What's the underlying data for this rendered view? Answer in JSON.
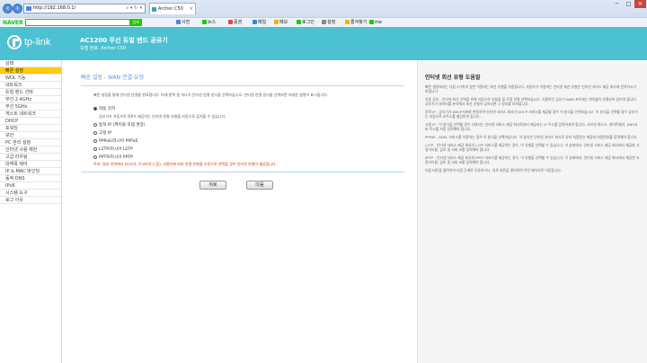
{
  "browser": {
    "address": "http://192.168.0.1/",
    "address_tools": "⌕ ▾ ↻ ✕",
    "tab_title": "Archer C50",
    "naver_logo": "NAVER",
    "naver_go": "검색",
    "toolbar": [
      {
        "label": "사전",
        "color": "#4f84d0"
      },
      {
        "label": "뉴스",
        "color": "#1ec800"
      },
      {
        "label": "증권",
        "color": "#e04646"
      },
      {
        "label": "메일",
        "color": "#2c8bd6"
      },
      {
        "label": "메모",
        "color": "#f0b400"
      },
      {
        "label": "로그인",
        "color": "#1ec800"
      },
      {
        "label": "설정",
        "color": "#888888"
      },
      {
        "label": "즐겨찾기",
        "color": "#f0b400"
      },
      {
        "label": "me",
        "color": "#1ec800"
      }
    ],
    "win_min": "─",
    "win_max": "□",
    "win_close": "✕"
  },
  "header": {
    "logo": "tp-link",
    "title": "AC1200 무선 듀얼 밴드 공유기",
    "subtitle": "모델 번호: Archer C50"
  },
  "sidebar": {
    "items": [
      {
        "label": "상태",
        "active": false
      },
      {
        "label": "빠른 설정",
        "active": true
      },
      {
        "label": "WDL 기능",
        "active": false
      },
      {
        "label": "네트워크",
        "active": false
      },
      {
        "label": "듀얼 밴드 선택",
        "active": false
      },
      {
        "label": "무선 2.4GHz",
        "active": false
      },
      {
        "label": "무선 5GHz",
        "active": false
      },
      {
        "label": "게스트 네트워크",
        "active": false
      },
      {
        "label": "DHCP",
        "active": false
      },
      {
        "label": "포워딩",
        "active": false
      },
      {
        "label": "보안",
        "active": false
      },
      {
        "label": "PC 관리 설정",
        "active": false
      },
      {
        "label": "인터넷 사용 제한",
        "active": false
      },
      {
        "label": "고급 라우팅",
        "active": false
      },
      {
        "label": "대역폭 제어",
        "active": false
      },
      {
        "label": "IP & MAC 바인딩",
        "active": false
      },
      {
        "label": "동적 DNS",
        "active": false
      },
      {
        "label": "IPv6",
        "active": false
      },
      {
        "label": "시스템 도구",
        "active": false
      },
      {
        "label": "로그 아웃",
        "active": false
      }
    ]
  },
  "content": {
    "title": "빠른 설정 - WAN 연결 유형",
    "description": "빠른 설정을 통해 인터넷 연결을 완료합니다. 아래 항목 중 하나가 인터넷 연결 방식을 선택하십시오. 인터넷 연결 방식을 선택하면 자세한 설명이 표시됩니다.",
    "options": [
      {
        "label": "자동 감지",
        "selected": true,
        "note": "공유기가 자동으로 ISP가 제공하는 인터넷 연결 유형을 자동으로 감지할 수 있습니다."
      },
      {
        "label": "동적 IP (케이블 모뎀 권장)",
        "selected": false,
        "note": ""
      },
      {
        "label": "고정 IP",
        "selected": false,
        "note": ""
      },
      {
        "label": "PPPoE/러시아 PPPoE",
        "selected": false,
        "note": ""
      },
      {
        "label": "L2TP/러시아 L2TP",
        "selected": false,
        "note": ""
      },
      {
        "label": "PPTP/러시아 PPTP",
        "selected": false,
        "note": ""
      }
    ],
    "warning": "주의: 일부 지역에서 (러시아, 우크라이나 등), 사용자에 따라 연결 유형을 수동으로 선택할 경우 인터넷 연결이 제공합니다.",
    "back_button": "뒤로",
    "next_button": "다음"
  },
  "help": {
    "title": "인터넷 회선 유형 도움말",
    "paragraphs": [
      {
        "lead": "",
        "text": "빠른 설정에서는 다음 3가지의 일반 이용되는 회선 유형을 지원합니다. 사용자가 이용하는 인터넷 회선 유형은 인터넷 서비스 제공 회사에 문의하시기 바랍니다."
      },
      {
        "lead": "",
        "text": "자동 감지 - 인터넷 회선 선택을 위해 자동으로 유형을 및 모뎀 연결 선택하십시오. 사용하던 공유기 WAN 포트에는 케이블이 연결되어 있어야 합니다. 공유기가 데이터를 분석해서 회선 유형이 감지되면 그 정보를 보여줍니다."
      },
      {
        "lead": "",
        "text": "동적 IP - 공유기가 DHCP서버와 연동하여 인터넷 서비스 회사가 DHCP 서비스를 제공할 경우 이 방식을 선택하십시오. 이 방식을 선택할 경우 공유기는 자동으로 IP주소를 할당받게 됩니다."
      },
      {
        "lead": "",
        "text": "고정 IP - 이 방식을 선택할 경우 사용자는 인터넷 서비스 제공 회사로부터 제공되는 IP 주소를 입력하셔야 합니다. 서브넷 마스크, 게이트웨이, DNS서버 주소를 지정 입력해야 합니다."
      },
      {
        "lead": "",
        "text": "PPPoE - ADSL 서비스를 이용하는 경우 이 방식을 선택하십시오. 이 방식은 인터넷 서비스 회사로 부터 지정받은 계정과 비밀번호를 입력해야 합니다."
      },
      {
        "lead": "",
        "text": "L2TP - 인터넷 서비스 제공 회사의 L2TP 서비스를 제공하는 경우, 이 유형을 선택할 수 있습니다. 이 상태에서, 인터넷 서비스 제공 회사에서 제공한 사용자이름, 암호 및 서버 IP를 입력해야 합니다."
      },
      {
        "lead": "",
        "text": "PPTP - 인터넷 서비스 제공 회사의 PPTP 서비스를 제공하는 경우, 이 유형을 선택할 수 있습니다. 이 상태에서, 인터넷 서비스 제공 회사에서 제공한 사용자이름, 암호 및 서버 IP를 입력해야 합니다."
      }
    ],
    "footer_next": "다음",
    "footer_mid": " 버튼을 클릭하여 다음 단계로 이동하거나, ",
    "footer_back": "뒤로",
    "footer_end": " 버튼을 클릭하여 이전 페이지로 이동합니다."
  }
}
